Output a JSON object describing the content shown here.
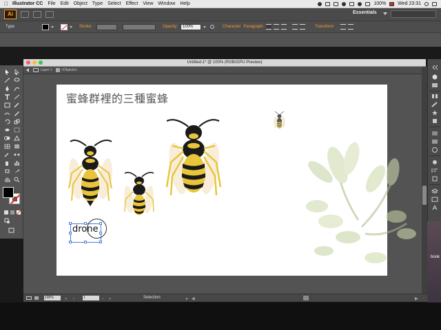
{
  "menubar": {
    "app_name": "Illustrator CC",
    "items": [
      "File",
      "Edit",
      "Object",
      "Type",
      "Select",
      "Effect",
      "View",
      "Window",
      "Help"
    ],
    "battery": "100%",
    "clock": "Wed 23:31"
  },
  "appbar": {
    "logo": "Ai",
    "workspace": "Essentials",
    "search_placeholder": ""
  },
  "control_bar": {
    "type_label": "Type",
    "stroke_label": "Stroke:",
    "opacity_label": "Opacity:",
    "opacity_value": "100%",
    "character_label": "Character",
    "paragraph_label": "Paragraph:",
    "transform_label": "Transform"
  },
  "document": {
    "title": "Untitled-1* @ 100% (RGB/GPU Preview)",
    "breadcrumb_layer": "Layer 1",
    "breadcrumb_object": "<Objects>"
  },
  "artboard": {
    "heading": "蜜蜂群裡的三種蜜蜂",
    "drone_text": "drone"
  },
  "status": {
    "zoom": "100%",
    "page": "1",
    "tool": "Selection"
  },
  "desktop": {
    "partial_label": "book"
  },
  "colors": {
    "bee_yellow": "#e9c53a",
    "bee_black": "#1a1a1a",
    "wing": "#f3e6c8",
    "leaf": "#c9d8a8",
    "ai_orange": "#f7a533",
    "selection_blue": "#4a7bd6"
  }
}
